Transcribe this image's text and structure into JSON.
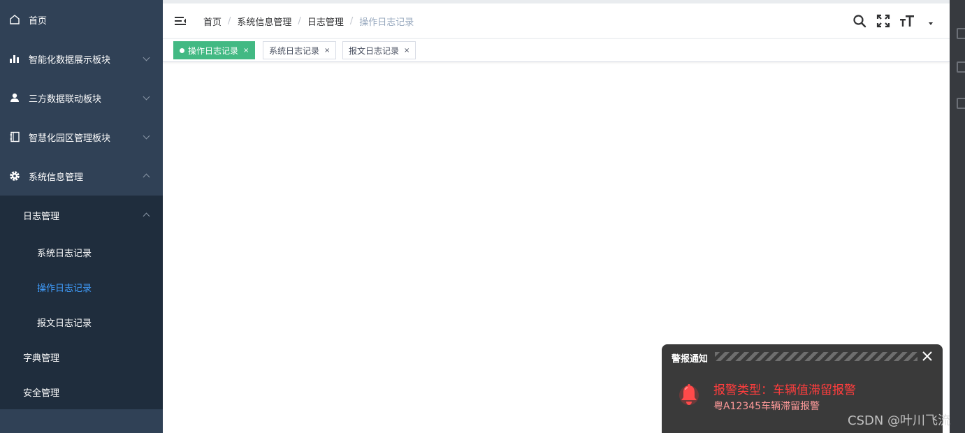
{
  "sidebar": {
    "items": [
      {
        "label": "首页",
        "icon": "home-icon"
      },
      {
        "label": "智能化数据展示板块",
        "icon": "bar-chart-icon"
      },
      {
        "label": "三方数据联动板块",
        "icon": "user-icon"
      },
      {
        "label": "智慧化园区管理板块",
        "icon": "notebook-icon"
      },
      {
        "label": "系统信息管理",
        "icon": "gear-icon"
      }
    ],
    "submenu": {
      "group_label": "日志管理",
      "children": [
        {
          "label": "系统日志记录"
        },
        {
          "label": "操作日志记录"
        },
        {
          "label": "报文日志记录"
        }
      ],
      "others": [
        {
          "label": "字典管理"
        },
        {
          "label": "安全管理"
        }
      ]
    },
    "active_color": "#409eff",
    "background": "#304156"
  },
  "breadcrumb": {
    "items": [
      "首页",
      "系统信息管理",
      "日志管理",
      "操作日志记录"
    ],
    "separator": "/"
  },
  "tags": [
    {
      "label": "操作日志记录",
      "active": true
    },
    {
      "label": "系统日志记录",
      "active": false
    },
    {
      "label": "报文日志记录",
      "active": false
    }
  ],
  "tag_close": "×",
  "tag_active_color": "#42b983",
  "toolbar": {
    "icons": [
      "search-icon",
      "fullscreen-icon",
      "font-size-icon",
      "dropdown-caret-icon"
    ]
  },
  "notification": {
    "title": "警报通知",
    "alarm_type": "报警类型：车辆值滞留报警",
    "detail": "粤A12345车辆滞留报警",
    "alarm_color": "#ff3d3d"
  },
  "watermark": "CSDN @叶川飞流"
}
